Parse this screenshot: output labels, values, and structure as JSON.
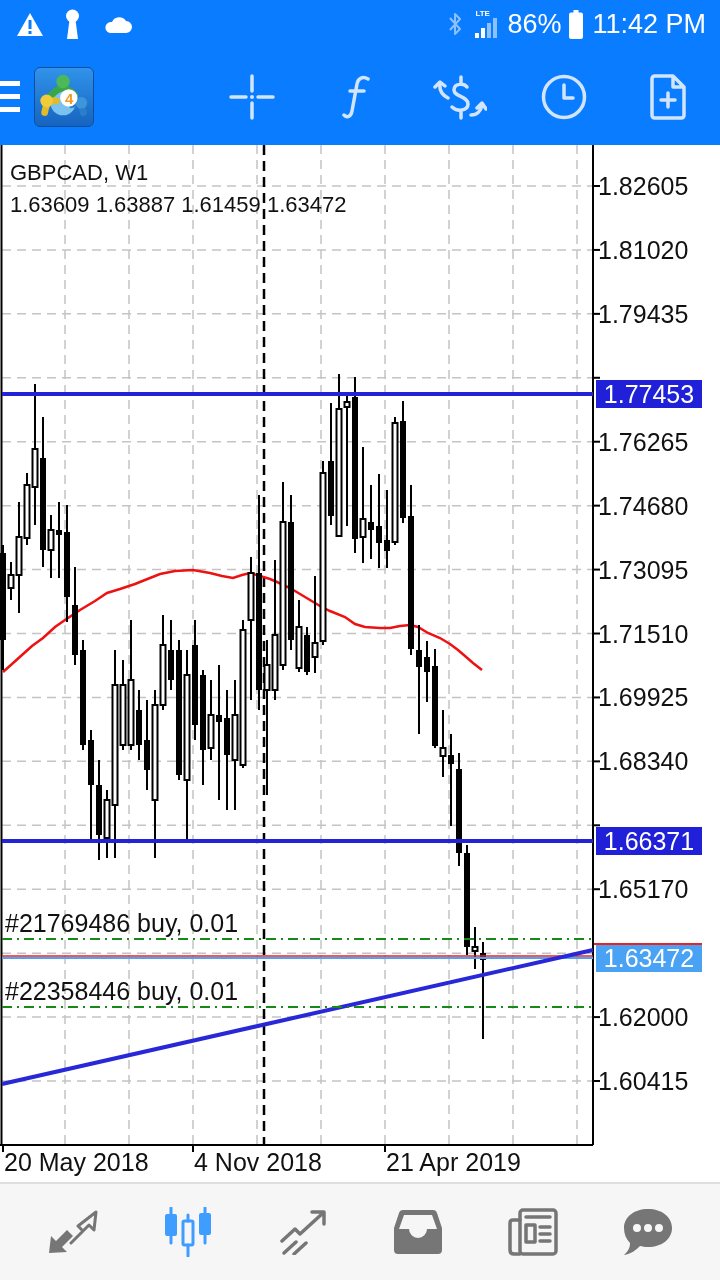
{
  "status_bar": {
    "network": "LTE",
    "battery": "86%",
    "time": "11:42 PM"
  },
  "toolbar": {
    "logo_badge": "4"
  },
  "chart": {
    "symbol": "GBPCAD, W1",
    "ohlc": "1.63609 1.63887 1.61459 1.63472",
    "price_ticks": [
      "1.82605",
      "1.81020",
      "1.79435",
      "1.76265",
      "1.74680",
      "1.73095",
      "1.71510",
      "1.69925",
      "1.68340",
      "1.65170",
      "1.62000",
      "1.60415"
    ],
    "time_ticks": [
      "20 May 2018",
      "4 Nov 2018",
      "21 Apr 2019"
    ],
    "price_lines": [
      {
        "kind": "level",
        "label": "1.77453"
      },
      {
        "kind": "level",
        "label": "1.66371"
      },
      {
        "kind": "bid",
        "label": "1.63472"
      }
    ],
    "orders": [
      {
        "label": "#21769486 buy, 0.01"
      },
      {
        "label": "#22358446 buy, 0.01"
      }
    ]
  },
  "bottom_nav": [
    {
      "kind": "quotes",
      "selected": false
    },
    {
      "kind": "chart",
      "selected": true
    },
    {
      "kind": "trade",
      "selected": false
    },
    {
      "kind": "history",
      "selected": false
    },
    {
      "kind": "news",
      "selected": false
    },
    {
      "kind": "messages",
      "selected": false
    }
  ]
}
